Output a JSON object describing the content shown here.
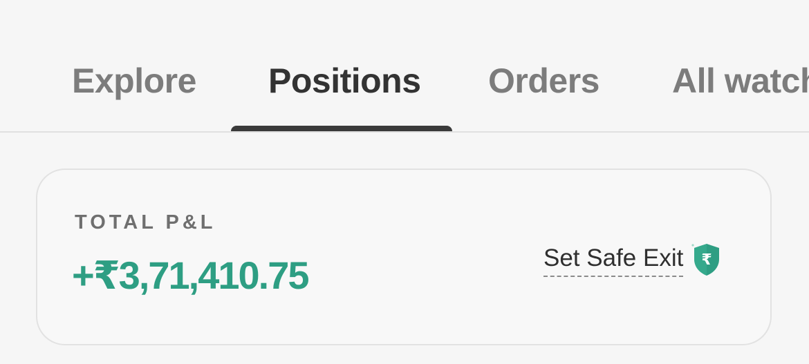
{
  "tabs": [
    {
      "label": "Explore",
      "active": false
    },
    {
      "label": "Positions",
      "active": true
    },
    {
      "label": "Orders",
      "active": false
    },
    {
      "label": "All watch",
      "active": false
    }
  ],
  "pnl_card": {
    "title": "TOTAL P&L",
    "value": "+₹3,71,410.75",
    "value_color": "#2e9e83",
    "safe_exit_label": "Set Safe Exit",
    "safe_exit_icon": "rupee-shield-icon"
  },
  "colors": {
    "accent_green": "#2e9e83",
    "active_tab": "#333333",
    "inactive_tab": "#7c7c7c"
  }
}
